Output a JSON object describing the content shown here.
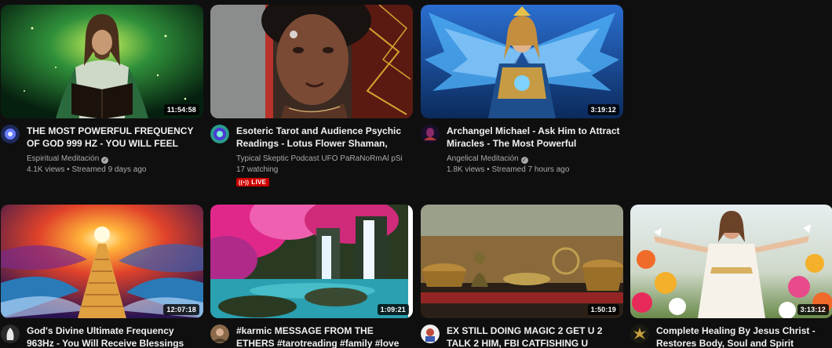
{
  "videos": [
    {
      "title": "THE MOST POWERFUL FREQUENCY OF GOD 999 HZ - YOU WILL FEEL GOD IN...",
      "channel": "Espiritual Meditación",
      "verified": true,
      "views": "4.1K views",
      "sep": "•",
      "age": "Streamed 9 days ago",
      "duration": "11:54:58"
    },
    {
      "title": "Esoteric Tarot and Audience Psychic Readings - Lotus Flower Shaman, TSP...",
      "channel": "Typical Skeptic Podcast UFO PaRaNoRmAl pSi",
      "verified": false,
      "watching": "17 watching",
      "live_label": "LIVE",
      "live_icon": "live-broadcast-icon"
    },
    {
      "title": "Archangel Michael - Ask Him to Attract Miracles - The Most Powerful Frequenc...",
      "channel": "Angelical Meditación",
      "verified": true,
      "views": "1.8K views",
      "sep": "•",
      "age": "Streamed 7 hours ago",
      "duration": "3:19:12"
    },
    {
      "title": "God's Divine Ultimate Frequency 963Hz - You Will Receive Blessings of...",
      "duration": "12:07:18"
    },
    {
      "title": "#karmic MESSAGE FROM THE ETHERS #tarotreading #family #love",
      "duration": "1:09:21"
    },
    {
      "title": "EX STILL DOING MAGIC 2 GET U 2 TALK 2 HIM, FBI CATFISHING U SECRETLY...",
      "duration": "1:50:19"
    },
    {
      "title": "Complete Healing By Jesus Christ - Restores Body, Soul and Spirit",
      "duration": "3:13:12"
    }
  ],
  "verified_icon": "check-circle-icon",
  "colors": {
    "background": "#0f0f0f",
    "title": "#f1f1f1",
    "secondary": "#aaaaaa",
    "live": "#cc0000"
  }
}
